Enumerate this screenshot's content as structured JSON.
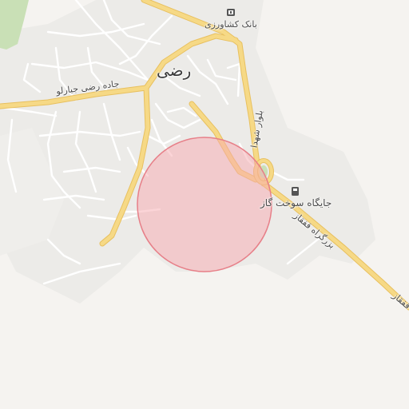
{
  "map": {
    "labels": {
      "town": "رضی",
      "bank": "بانک کشاورزی",
      "gas_station": "جایگاه سوخت گاز",
      "road_west": "جاده رضی جبارلو",
      "boulevard": "بلوار شهدا",
      "highway": "بزرگراه قفقاز",
      "highway_edge": "قفقاز"
    },
    "icons": {
      "bank": "bank-icon",
      "gas_station": "fuel-pump-icon"
    },
    "colors": {
      "background": "#f5f3f0",
      "urban": "#ecebe8",
      "major_road": "#f6d986",
      "major_road_casing": "#e8c05f",
      "minor_road": "#ffffff",
      "park": "#c9e0b6",
      "search_radius_fill": "#f7a9b0",
      "search_radius_stroke": "#e77f88"
    }
  }
}
